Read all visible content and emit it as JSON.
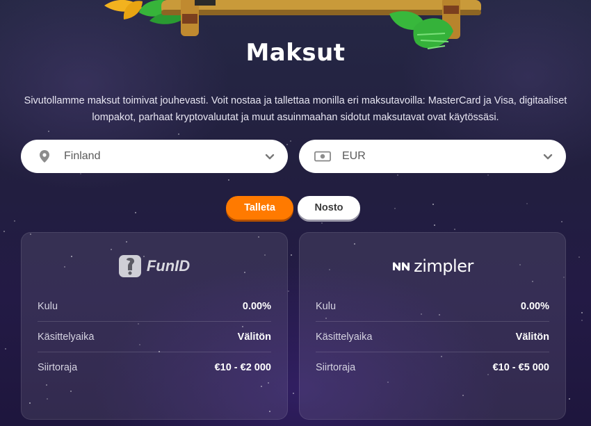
{
  "page": {
    "title": "Maksut",
    "intro": "Sivutollamme maksut toimivat jouhevasti. Voit nostaa ja tallettaa monilla eri maksutavoilla: MasterCard ja Visa, digitaaliset lompakot, parhaat kryptovaluutat ja muut asuinmaahan sidotut maksutavat ovat käytössäsi."
  },
  "filters": {
    "country": {
      "value": "Finland",
      "icon": "location-pin-icon"
    },
    "currency": {
      "value": "EUR",
      "icon": "banknote-icon"
    }
  },
  "tabs": {
    "deposit": "Talleta",
    "withdraw": "Nosto",
    "active": "deposit"
  },
  "methods": [
    {
      "name": "FunID",
      "rows": [
        {
          "label": "Kulu",
          "value": "0.00%"
        },
        {
          "label": "Käsittelyaika",
          "value": "Välitön"
        },
        {
          "label": "Siirtoraja",
          "value": "€10 - €2 000"
        }
      ]
    },
    {
      "name": "zimpler",
      "rows": [
        {
          "label": "Kulu",
          "value": "0.00%"
        },
        {
          "label": "Käsittelyaika",
          "value": "Välitön"
        },
        {
          "label": "Siirtoraja",
          "value": "€10 - €5 000"
        }
      ]
    }
  ],
  "colors": {
    "accent": "#ff7a00",
    "background": "#231c44",
    "card": "#3a3258"
  }
}
